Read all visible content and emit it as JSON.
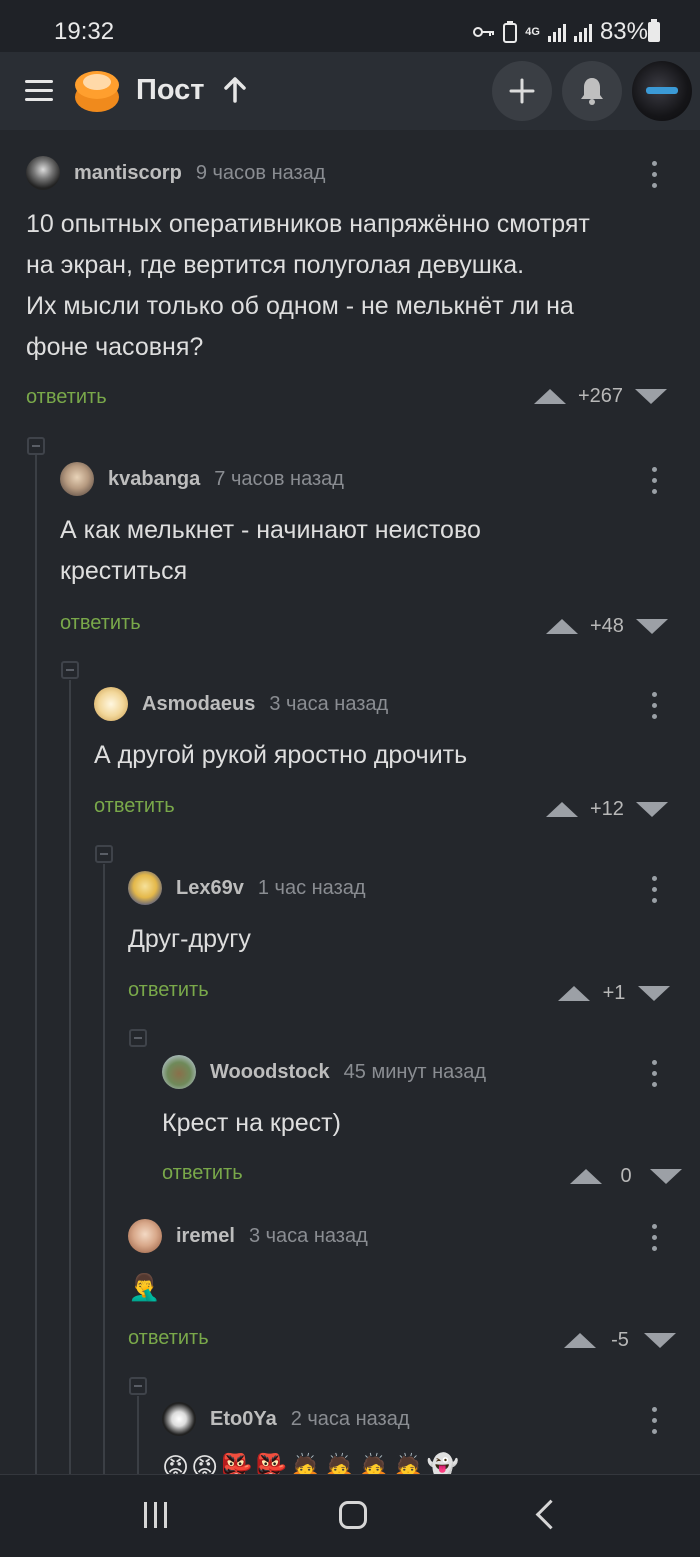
{
  "status_bar": {
    "time": "19:32",
    "network": "4G",
    "battery": "83%"
  },
  "header": {
    "title": "Пост"
  },
  "comments": [
    {
      "user": "mantiscorp",
      "time": "9 часов назад",
      "text": "10 опытных оперативников напряжённо смотрят\nна экран, где вертится полуголая девушка.\nИх мысли только об одном - не мелькнёт ли на\nфоне часовня?",
      "reply": "ответить",
      "score": "+267"
    },
    {
      "user": "kvabanga",
      "time": "7 часов назад",
      "text": "А как мелькнет - начинают неистово\nкреститься",
      "reply": "ответить",
      "score": "+48"
    },
    {
      "user": "Asmodaeus",
      "time": "3 часа назад",
      "text": "А другой рукой яростно дрочить",
      "reply": "ответить",
      "score": "+12"
    },
    {
      "user": "Lex69v",
      "time": "1 час назад",
      "text": "Друг-другу",
      "reply": "ответить",
      "score": "+1"
    },
    {
      "user": "Wooodstock",
      "time": "45 минут назад",
      "text": "Крест на крест)",
      "reply": "ответить",
      "score": "0"
    },
    {
      "user": "iremel",
      "time": "3 часа назад",
      "text": "🤦‍♂️",
      "reply": "ответить",
      "score": "-5"
    },
    {
      "user": "Eto0Ya",
      "time": "2 часа назад",
      "text": "😡😡👺👺🙇🙇🙇🙇👻",
      "reply": "",
      "score": ""
    }
  ],
  "colors": {
    "background": "#24272c",
    "reply_link": "#79a84a",
    "username": "#bdbdbd"
  },
  "icons": [
    "menu-icon",
    "pikabu-logo",
    "arrow-up-icon",
    "plus-icon",
    "bell-icon",
    "more-vertical-icon",
    "vote-up-icon",
    "vote-down-icon",
    "collapse-icon"
  ]
}
